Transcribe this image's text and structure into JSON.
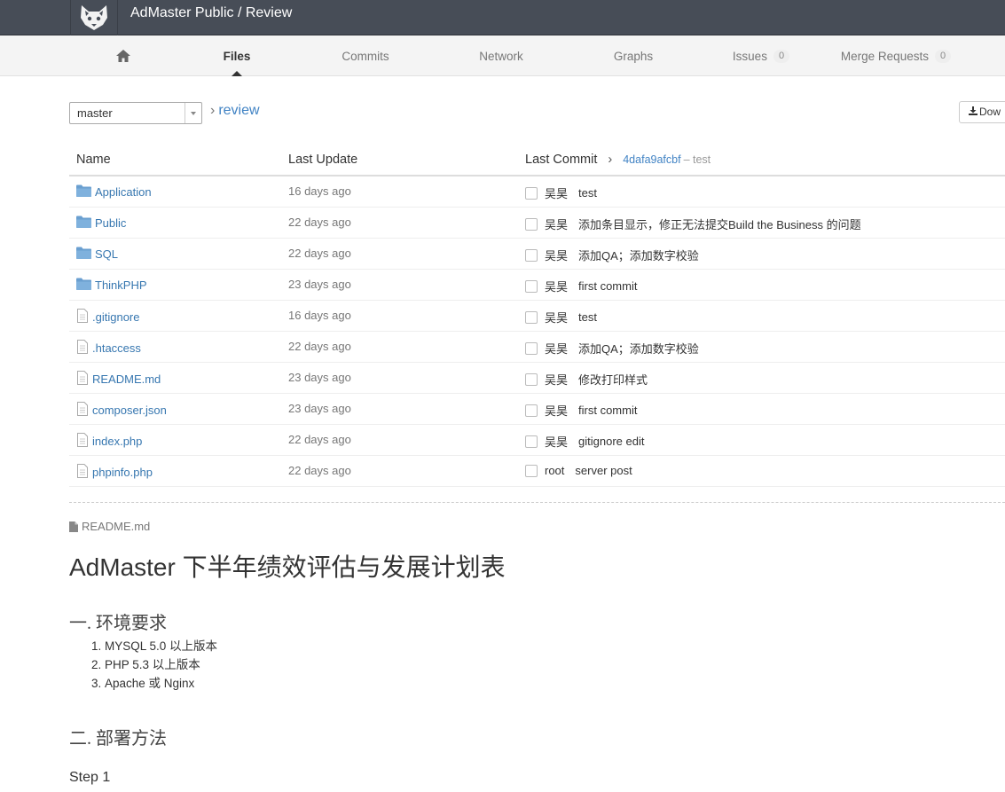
{
  "header": {
    "project_title": "AdMaster Public / Review"
  },
  "nav": {
    "files": "Files",
    "commits": "Commits",
    "network": "Network",
    "graphs": "Graphs",
    "issues": "Issues",
    "issues_count": "0",
    "merge_requests": "Merge Requests",
    "merge_requests_count": "0"
  },
  "branch": {
    "selected": "master",
    "path": "review",
    "download_label": "Dow"
  },
  "table": {
    "headers": {
      "name": "Name",
      "last_update": "Last Update",
      "last_commit": "Last Commit",
      "commit_hash": "4dafa9afcbf",
      "commit_msg": "– test"
    },
    "rows": [
      {
        "type": "folder",
        "name": "Application",
        "date": "16 days ago",
        "author": "吴昊",
        "message": "test"
      },
      {
        "type": "folder",
        "name": "Public",
        "date": "22 days ago",
        "author": "吴昊",
        "message": "添加条目显示，修正无法提交Build the Business 的问题"
      },
      {
        "type": "folder",
        "name": "SQL",
        "date": "22 days ago",
        "author": "吴昊",
        "message": "添加QA；添加数字校验"
      },
      {
        "type": "folder",
        "name": "ThinkPHP",
        "date": "23 days ago",
        "author": "吴昊",
        "message": "first commit"
      },
      {
        "type": "file",
        "name": ".gitignore",
        "date": "16 days ago",
        "author": "吴昊",
        "message": "test"
      },
      {
        "type": "file",
        "name": ".htaccess",
        "date": "22 days ago",
        "author": "吴昊",
        "message": "添加QA；添加数字校验"
      },
      {
        "type": "file",
        "name": "README.md",
        "date": "23 days ago",
        "author": "吴昊",
        "message": "修改打印样式"
      },
      {
        "type": "file",
        "name": "composer.json",
        "date": "23 days ago",
        "author": "吴昊",
        "message": "first commit"
      },
      {
        "type": "file",
        "name": "index.php",
        "date": "22 days ago",
        "author": "吴昊",
        "message": "gitignore edit"
      },
      {
        "type": "file",
        "name": "phpinfo.php",
        "date": "22 days ago",
        "author": "root",
        "message": "server post"
      }
    ]
  },
  "readme": {
    "file_label": "README.md",
    "title": "AdMaster 下半年绩效评估与发展计划表",
    "section1": "一. 环境要求",
    "requirements": [
      "MYSQL 5.0 以上版本",
      "PHP 5.3 以上版本",
      "Apache 或 Nginx"
    ],
    "section2": "二. 部署方法",
    "step1": "Step 1"
  },
  "colors": {
    "header_bg": "#474d57",
    "link": "#3777b0",
    "folder": "#6a9fd0"
  },
  "icons": {
    "logo": "fox-logo",
    "home": "home-icon",
    "folder": "folder-icon",
    "file": "file-icon",
    "download": "download-icon"
  }
}
